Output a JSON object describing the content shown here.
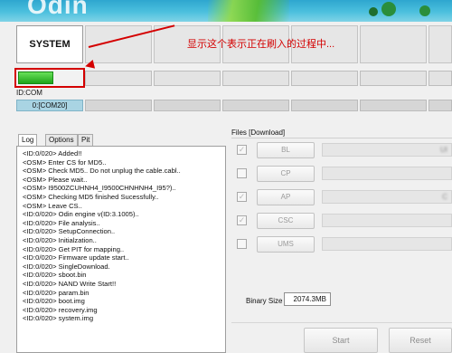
{
  "banner": {
    "logo_text": "Odin"
  },
  "slots": {
    "active_label": "SYSTEM",
    "progress_percent": 55
  },
  "annotation": "显示这个表示正在刷入的过程中...",
  "id_com": {
    "label": "ID:COM",
    "port": "0:[COM20]"
  },
  "tabs": [
    "Log",
    "Options",
    "Pit"
  ],
  "log_lines": [
    "<ID:0/020> Added!!",
    "<OSM> Enter CS for MD5..",
    "<OSM> Check MD5.. Do not unplug the cable.cabl..",
    "<OSM> Please wait..",
    "<OSM> I9500ZCUHNH4_I9500CHNHNH4_I95?)..",
    "<OSM> Checking MD5 finished Sucessfully..",
    "<OSM> Leave CS..",
    "<ID:0/020> Odin engine v(ID:3.1005)..",
    "<ID:0/020> File analysis..",
    "<ID:0/020> SetupConnection..",
    "<ID:0/020> Initialzation..",
    "<ID:0/020> Get PIT for mapping..",
    "<ID:0/020> Firmware update start..",
    "<ID:0/020> SingleDownload.",
    "<ID:0/020> sboot.bin",
    "<ID:0/020> NAND Write Start!!",
    "<ID:0/020> param.bin",
    "<ID:0/020> boot.img",
    "<ID:0/020> recovery.img",
    "<ID:0/020> system.img"
  ],
  "files": {
    "title": "Files [Download]",
    "rows": [
      {
        "label": "BL",
        "checked": true,
        "path": "UI"
      },
      {
        "label": "CP",
        "checked": false,
        "path": ""
      },
      {
        "label": "AP",
        "checked": true,
        "path": "C"
      },
      {
        "label": "CSC",
        "checked": true,
        "path": ""
      },
      {
        "label": "UMS",
        "checked": false,
        "path": ""
      }
    ]
  },
  "binary": {
    "label": "Binary Size",
    "value": "2074.3MB"
  },
  "buttons": {
    "start": "Start",
    "reset": "Reset"
  },
  "colors": {
    "annotation": "#d40000",
    "progress": "#1fa51b",
    "port_active": "#a9d4e3"
  }
}
